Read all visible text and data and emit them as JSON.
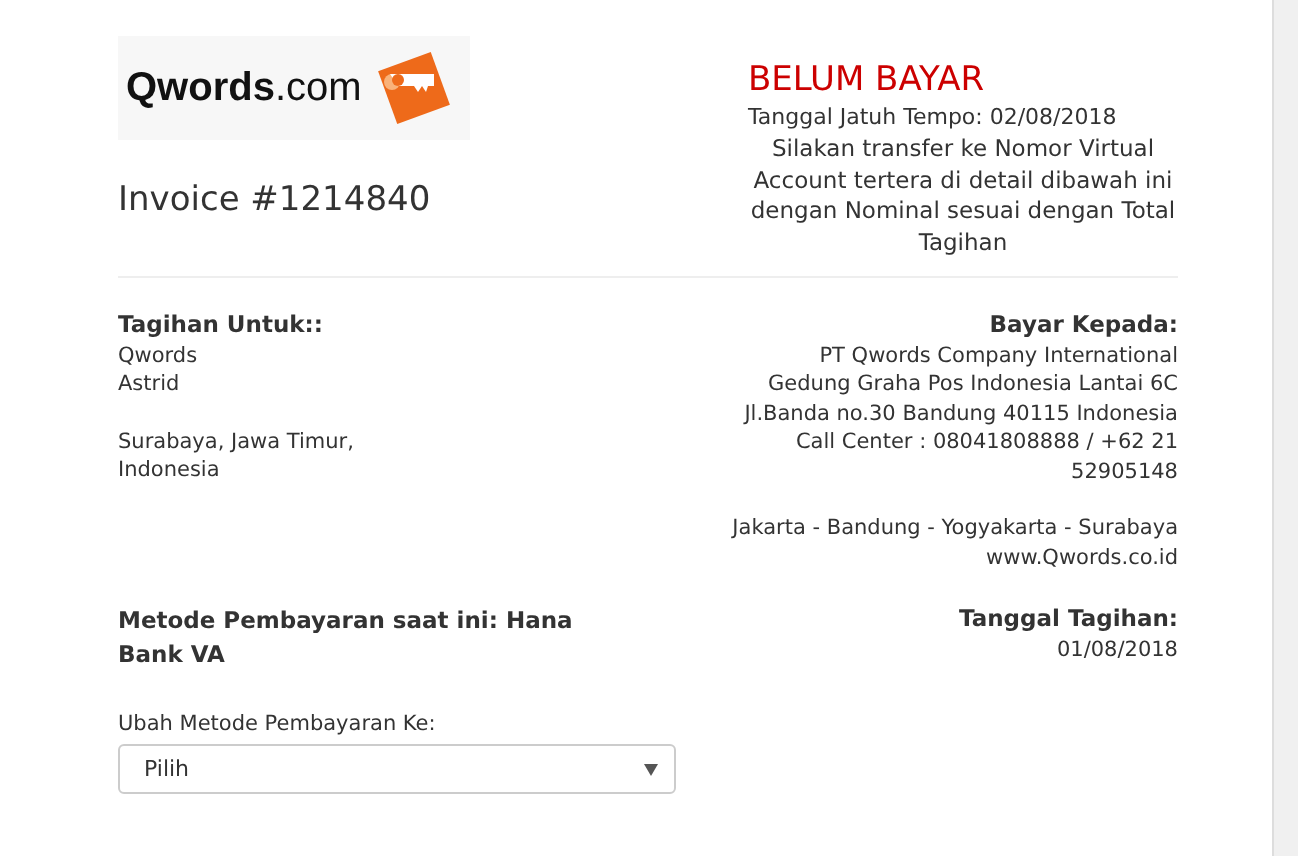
{
  "logo": {
    "text": "**Qwords**.com"
  },
  "invoice_title": "Invoice #1214840",
  "status": {
    "label": "BELUM BAYAR",
    "due_date": "Tanggal Jatuh Tempo: 02/08/2018",
    "instruction": "Silakan transfer ke Nomor Virtual Account tertera di detail dibawah ini dengan Nominal sesuai dengan Total Tagihan"
  },
  "bill_to": {
    "heading": "Tagihan Untuk::",
    "blocks": [
      [
        "Qwords",
        "Astrid"
      ],
      [
        "Surabaya, Jawa Timur, Indonesia"
      ]
    ]
  },
  "pay_to": {
    "heading": "Bayar Kepada:",
    "blocks": [
      [
        "PT Qwords Company International",
        "Gedung Graha Pos Indonesia Lantai 6C",
        "Jl.Banda no.30 Bandung 40115 Indonesia",
        "Call Center : 08041808888 / +62 21 52905148"
      ],
      [
        "Jakarta - Bandung - Yogyakarta - Surabaya",
        "www.Qwords.co.id"
      ]
    ]
  },
  "payment_method": {
    "text": "Metode Pembayaran saat ini: Hana Bank VA"
  },
  "invoice_date": {
    "heading": "Tanggal Tagihan:",
    "value": "01/08/2018"
  },
  "change_method": {
    "label": "Ubah Metode Pembayaran Ke:",
    "value": "Pilih"
  }
}
